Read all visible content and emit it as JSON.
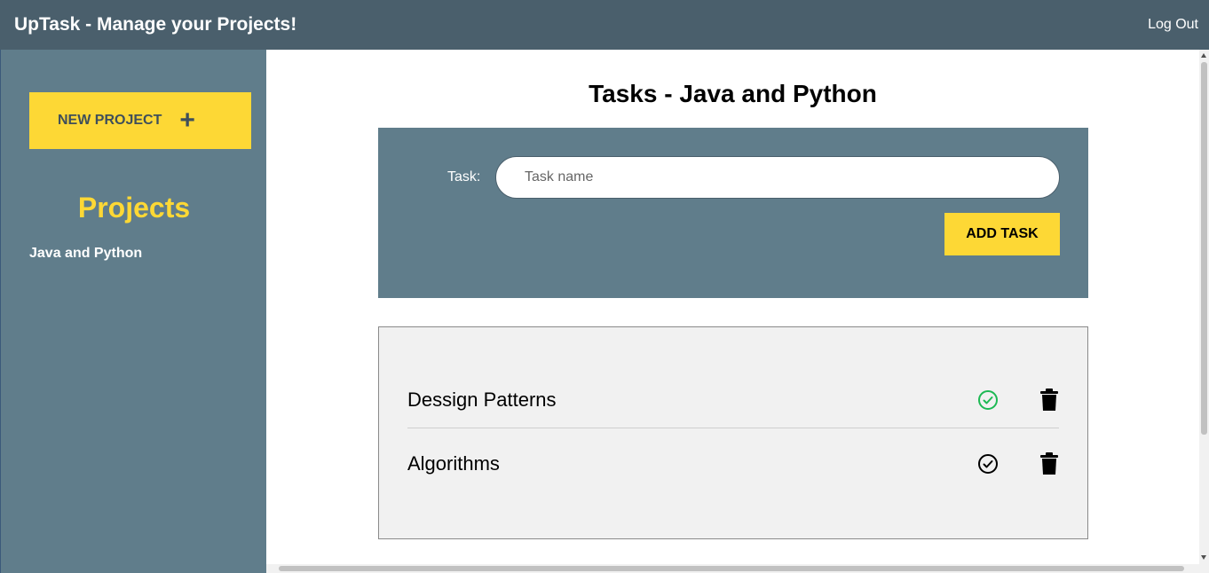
{
  "header": {
    "title": "UpTask - Manage your Projects!",
    "logout_label": "Log Out"
  },
  "sidebar": {
    "new_project_label": "NEW PROJECT",
    "new_project_icon": "plus-icon",
    "projects_heading": "Projects",
    "projects": [
      {
        "label": "Java and Python"
      }
    ]
  },
  "main": {
    "title": "Tasks - Java and Python",
    "form": {
      "task_label": "Task:",
      "task_input_value": "",
      "task_input_placeholder": "Task name",
      "add_task_label": "ADD TASK"
    },
    "tasks": [
      {
        "name": "Dessign Patterns",
        "completed": true,
        "complete_icon": "check-circle-icon",
        "delete_icon": "trash-icon"
      },
      {
        "name": "Algorithms",
        "completed": false,
        "complete_icon": "check-circle-icon",
        "delete_icon": "trash-icon"
      }
    ]
  },
  "colors": {
    "header_bg": "#4a5f6c",
    "sidebar_bg": "#607d8b",
    "accent": "#fdd835",
    "completed_check": "#1db954",
    "pending_check": "#000000"
  }
}
